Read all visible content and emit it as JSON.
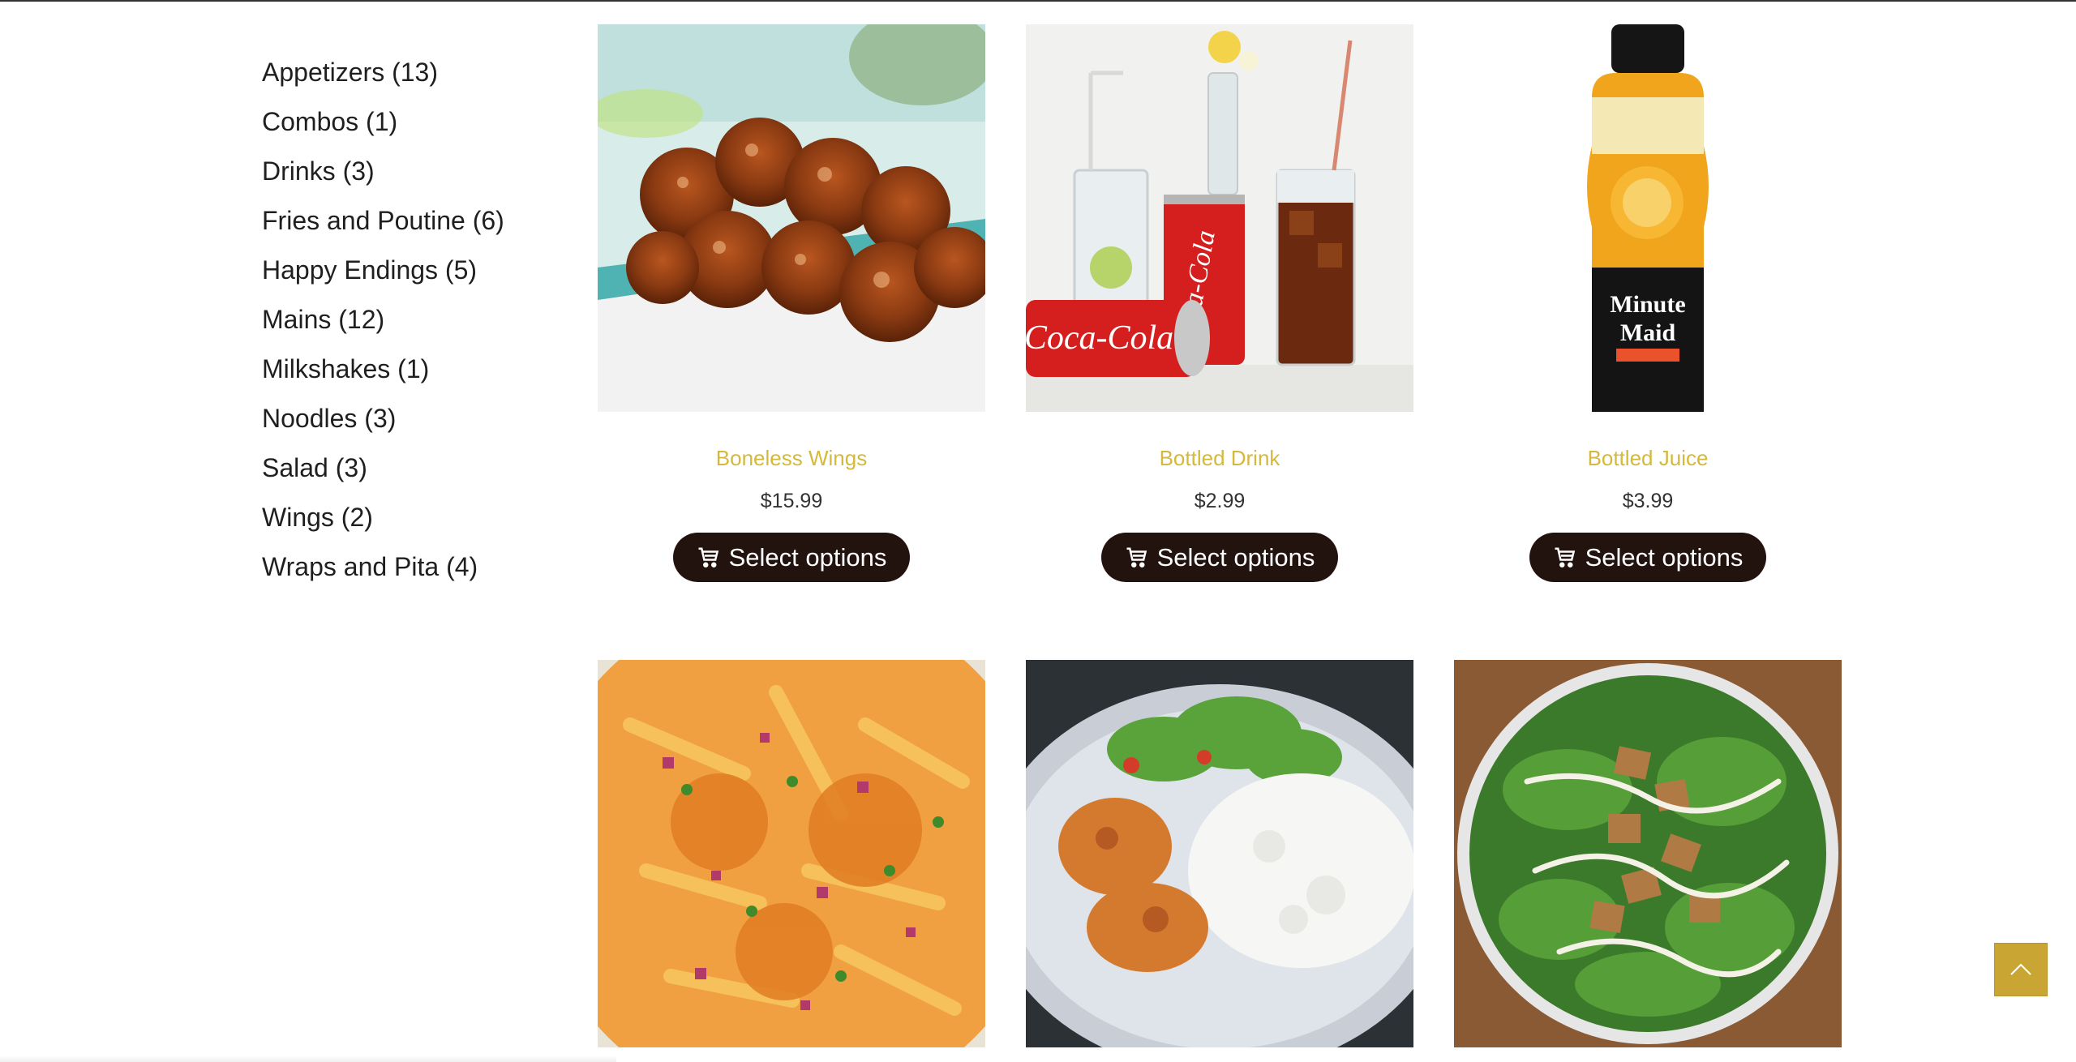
{
  "categories": [
    "Appetizers (13)",
    "Combos (1)",
    "Drinks (3)",
    "Fries and Poutine (6)",
    "Happy Endings (5)",
    "Mains (12)",
    "Milkshakes (1)",
    "Noodles (3)",
    "Salad (3)",
    "Wings (2)",
    "Wraps and Pita (4)"
  ],
  "products": [
    {
      "name": "Boneless Wings",
      "price": "$15.99",
      "button": "Select options"
    },
    {
      "name": "Bottled Drink",
      "price": "$2.99",
      "button": "Select options"
    },
    {
      "name": "Bottled Juice",
      "price": "$3.99",
      "button": "Select options"
    }
  ],
  "icons": {
    "cart": "shopping-cart-icon",
    "scroll_top": "chevron-up-icon"
  },
  "colors": {
    "product_name": "#d4b93a",
    "button_bg": "#23130f",
    "scroll_top_bg": "#c9a633"
  }
}
